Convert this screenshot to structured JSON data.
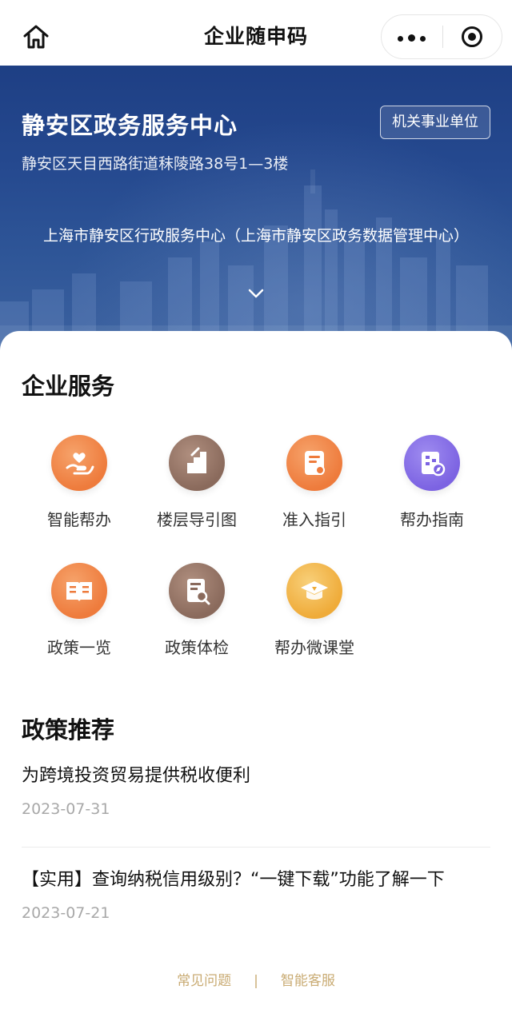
{
  "navbar": {
    "title": "企业随申码",
    "home_icon": "home-icon",
    "more_icon": "more-dots-icon",
    "close_icon": "target-close-icon"
  },
  "banner": {
    "org_name": "静安区政务服务中心",
    "org_tag": "机关事业单位",
    "address": "静安区天目西路街道秣陵路38号1—3楼",
    "description": "上海市静安区行政服务中心（上海市静安区政务数据管理中心）",
    "expand_icon": "chevron-down-icon"
  },
  "services": {
    "title": "企业服务",
    "items": [
      {
        "label": "智能帮办",
        "icon": "heart-hand-icon",
        "color": "#ee7b3c"
      },
      {
        "label": "楼层导引图",
        "icon": "stairs-icon",
        "color": "#8a6a5c"
      },
      {
        "label": "准入指引",
        "icon": "document-icon",
        "color": "#ee7b3c"
      },
      {
        "label": "帮办指南",
        "icon": "guide-compass-icon",
        "color": "#7c63e2"
      },
      {
        "label": "政策一览",
        "icon": "open-book-icon",
        "color": "#ee7b3c"
      },
      {
        "label": "政策体检",
        "icon": "document-search-icon",
        "color": "#8a6a5c"
      },
      {
        "label": "帮办微课堂",
        "icon": "graduation-cap-icon",
        "color": "#efab39"
      }
    ]
  },
  "policy": {
    "title": "政策推荐",
    "items": [
      {
        "title": "为跨境投资贸易提供税收便利",
        "date": "2023-07-31"
      },
      {
        "title": "【实用】查询纳税信用级别？“一键下载”功能了解一下",
        "date": "2023-07-21"
      }
    ]
  },
  "footer": {
    "faq": "常见问题",
    "separator": "|",
    "service": "智能客服"
  }
}
